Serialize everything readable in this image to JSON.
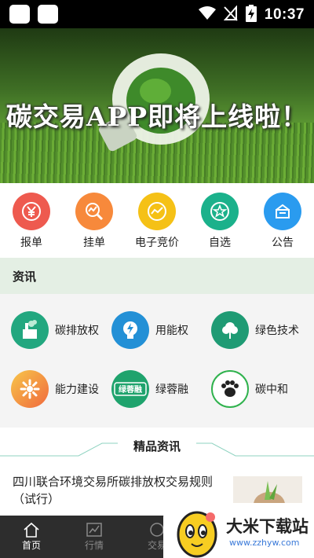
{
  "status_bar": {
    "time": "10:37",
    "wifi_icon": "wifi-icon",
    "signal_icon": "no-signal-icon",
    "battery_icon": "battery-charging-icon"
  },
  "banner": {
    "title": "碳交易APP即将上线啦！",
    "slide_index": 1
  },
  "quick_nav": [
    {
      "label": "报单",
      "icon": "yuan-icon",
      "color": "#ee5a4f"
    },
    {
      "label": "挂单",
      "icon": "chart-search-icon",
      "color": "#f7893b"
    },
    {
      "label": "电子竞价",
      "icon": "trend-icon",
      "color": "#f5c116"
    },
    {
      "label": "自选",
      "icon": "star-icon",
      "color": "#1bb18b"
    },
    {
      "label": "公告",
      "icon": "store-icon",
      "color": "#2a9bef"
    }
  ],
  "section": {
    "title": "资讯"
  },
  "categories": [
    {
      "label": "碳排放权",
      "icon": "factory-icon"
    },
    {
      "label": "用能权",
      "icon": "energy-bolt-icon"
    },
    {
      "label": "绿色技术",
      "icon": "tree-icon"
    },
    {
      "label": "能力建设",
      "icon": "flower-icon"
    },
    {
      "label": "绿蓉融",
      "icon": "green-finance-icon",
      "icon_text": "绿蓉融"
    },
    {
      "label": "碳中和",
      "icon": "paw-icon"
    }
  ],
  "featured": {
    "title": "精品资讯",
    "articles": [
      {
        "title": "四川联合环境交易所碳排放权交易规则（试行）"
      }
    ]
  },
  "tabs": [
    {
      "label": "首页",
      "icon": "home-icon",
      "active": true
    },
    {
      "label": "行情",
      "icon": "market-chart-icon",
      "active": false
    },
    {
      "label": "交易",
      "icon": "trade-icon",
      "active": false
    }
  ],
  "watermark": {
    "name": "大米下载站",
    "url": "www.zzhyw.com"
  },
  "colors": {
    "accent_green": "#1bb18b",
    "tab_bar": "#2d2d2d",
    "section_bg": "#e4efe4"
  }
}
